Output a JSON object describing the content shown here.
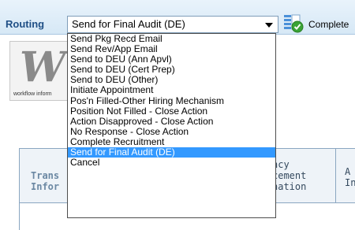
{
  "toolbar": {
    "title": "Routing",
    "routing_value": "Send for Final Audit (DE)",
    "complete_label": "Complete"
  },
  "logo": {
    "letter": "W",
    "tagline": "workflow inform"
  },
  "grid": {
    "col1_header": "Trans\nInfor",
    "col2_header": "ncy\ncement\nnation",
    "col3_header": "A\nIn"
  },
  "dropdown": {
    "selected_index": 13,
    "options": [
      "Send Pkg Recd Email",
      "Send Rev/App Email",
      "Send to DEU (Ann Apvl)",
      "Send to DEU (Cert Prep)",
      "Send to DEU (Other)",
      "Initiate Appointment",
      "Pos'n Filled-Other Hiring Mechanism",
      "Position Not Filled - Close Action",
      "Action Disapproved - Close Action",
      "No Response - Close Action",
      "Complete Recruitment",
      "Send for Final Audit (DE)",
      "Cancel"
    ]
  },
  "colors": {
    "toolbar_title": "#1f4f86",
    "selected_bg": "#3399ff",
    "selected_fg": "#ffffff"
  },
  "icons": {
    "complete": "checkmark-document-icon",
    "dropdown_arrow": "chevron-down-icon"
  }
}
